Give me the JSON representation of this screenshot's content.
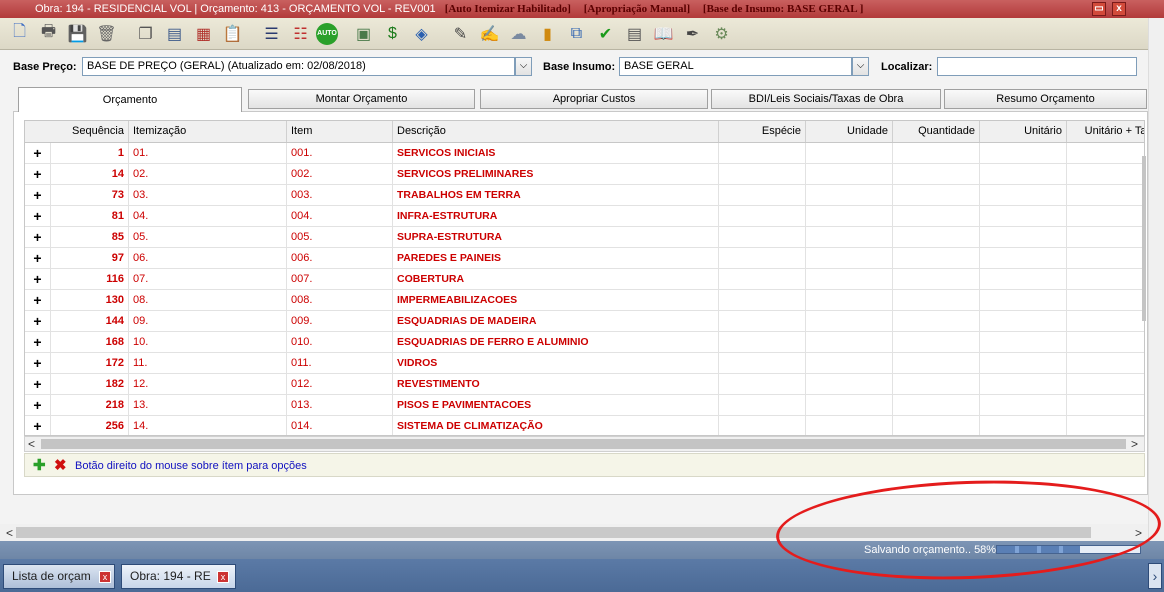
{
  "window": {
    "title": "Obra: 194 - RESIDENCIAL VOL | Orçamento: 413 - ORÇAMENTO VOL - REV001",
    "tags": [
      "[Auto Itemizar Habilitado]",
      "[Apropriação Manual]",
      "[Base de Insumo: BASE GERAL ]"
    ],
    "restore_icon": "▭",
    "close_icon": "x"
  },
  "toolbar": {
    "icons": [
      {
        "name": "new-document-icon",
        "glyph": "🗋",
        "color": "#3a6bc4"
      },
      {
        "name": "print-icon",
        "glyph": "🖶",
        "color": "#555"
      },
      {
        "name": "save-icon",
        "glyph": "💾",
        "color": "#2a4fa0"
      },
      {
        "name": "delete-icon",
        "glyph": "🗑",
        "color": "#666"
      },
      {
        "name": "copy-icon",
        "glyph": "❐",
        "color": "#555"
      },
      {
        "name": "report-icon",
        "glyph": "▤",
        "color": "#3d5a8a"
      },
      {
        "name": "table-icon",
        "glyph": "▦",
        "color": "#b0302a"
      },
      {
        "name": "clipboard-icon",
        "glyph": "📋",
        "color": "#666"
      },
      {
        "name": "list-icon",
        "glyph": "☰",
        "color": "#2a3a70"
      },
      {
        "name": "chart-list-icon",
        "glyph": "☷",
        "color": "#c03030"
      },
      {
        "name": "auto-icon",
        "glyph": "AUTO",
        "color": "#1a8a1a"
      },
      {
        "name": "calculator-icon",
        "glyph": "▣",
        "color": "#4a7a4a"
      },
      {
        "name": "money-icon",
        "glyph": "$",
        "color": "#1a7a1a"
      },
      {
        "name": "tag-icon",
        "glyph": "◈",
        "color": "#2a60b0"
      },
      {
        "name": "tools-icon",
        "glyph": "✎",
        "color": "#444"
      },
      {
        "name": "edit-icon",
        "glyph": "✍",
        "color": "#555"
      },
      {
        "name": "cloud-icon",
        "glyph": "☁",
        "color": "#7a8aa0"
      },
      {
        "name": "bar-chart-icon",
        "glyph": "▮",
        "color": "#d08a10"
      },
      {
        "name": "import-icon",
        "glyph": "⧉",
        "color": "#2a60b0"
      },
      {
        "name": "check-icon",
        "glyph": "✔",
        "color": "#1a9a1a"
      },
      {
        "name": "document-list-icon",
        "glyph": "▤",
        "color": "#555"
      },
      {
        "name": "book-icon",
        "glyph": "📖",
        "color": "#2a60b0"
      },
      {
        "name": "pen-icon",
        "glyph": "✒",
        "color": "#444"
      },
      {
        "name": "settings-icon",
        "glyph": "⚙",
        "color": "#6a8a5a"
      }
    ]
  },
  "filters": {
    "base_preco_label": "Base Preço:",
    "base_preco_value": "BASE DE PREÇO (GERAL) (Atualizado em: 02/08/2018)",
    "base_insumo_label": "Base Insumo:",
    "base_insumo_value": "BASE GERAL",
    "localizar_label": "Localizar:",
    "localizar_value": "",
    "dropdown_glyph": "⌵"
  },
  "tabs": [
    {
      "label": "Orçamento",
      "active": true
    },
    {
      "label": "Montar Orçamento",
      "active": false
    },
    {
      "label": "Apropriar Custos",
      "active": false
    },
    {
      "label": "BDI/Leis Sociais/Taxas de Obra",
      "active": false
    },
    {
      "label": "Resumo Orçamento",
      "active": false
    }
  ],
  "grid": {
    "columns": [
      "Sequência",
      "Itemização",
      "Item",
      "Descrição",
      "Espécie",
      "Unidade",
      "Quantidade",
      "Unitário",
      "Unitário + Tax"
    ],
    "expand_glyph": "+",
    "rows": [
      {
        "seq": "1",
        "itemizacao": "01.",
        "item": "001.",
        "descricao": "SERVICOS INICIAIS"
      },
      {
        "seq": "14",
        "itemizacao": "02.",
        "item": "002.",
        "descricao": "SERVICOS PRELIMINARES"
      },
      {
        "seq": "73",
        "itemizacao": "03.",
        "item": "003.",
        "descricao": "TRABALHOS EM TERRA"
      },
      {
        "seq": "81",
        "itemizacao": "04.",
        "item": "004.",
        "descricao": "INFRA-ESTRUTURA"
      },
      {
        "seq": "85",
        "itemizacao": "05.",
        "item": "005.",
        "descricao": "SUPRA-ESTRUTURA"
      },
      {
        "seq": "97",
        "itemizacao": "06.",
        "item": "006.",
        "descricao": "PAREDES E PAINEIS"
      },
      {
        "seq": "116",
        "itemizacao": "07.",
        "item": "007.",
        "descricao": "COBERTURA"
      },
      {
        "seq": "130",
        "itemizacao": "08.",
        "item": "008.",
        "descricao": "IMPERMEABILIZACOES"
      },
      {
        "seq": "144",
        "itemizacao": "09.",
        "item": "009.",
        "descricao": "ESQUADRIAS DE MADEIRA"
      },
      {
        "seq": "168",
        "itemizacao": "10.",
        "item": "010.",
        "descricao": "ESQUADRIAS DE FERRO E ALUMINIO"
      },
      {
        "seq": "172",
        "itemizacao": "11.",
        "item": "011.",
        "descricao": "VIDROS"
      },
      {
        "seq": "182",
        "itemizacao": "12.",
        "item": "012.",
        "descricao": "REVESTIMENTO"
      },
      {
        "seq": "218",
        "itemizacao": "13.",
        "item": "013.",
        "descricao": "PISOS E PAVIMENTACOES"
      },
      {
        "seq": "256",
        "itemizacao": "14.",
        "item": "014.",
        "descricao": "SISTEMA DE CLIMATIZAÇÃO"
      }
    ]
  },
  "footer": {
    "add_icon": "✚",
    "remove_icon": "✖",
    "hint": "Botão direito do mouse sobre ítem para opções"
  },
  "scroll": {
    "left": "<",
    "right": ">"
  },
  "status": {
    "text": "Salvando orçamento.. 58%",
    "progress": 0.58
  },
  "taskbar": {
    "tasks": [
      "Lista de orçam",
      "Obra: 194 - RE"
    ],
    "close_glyph": "x",
    "right_glyph": "›"
  },
  "colors": {
    "row_text": "#cc0000",
    "annotation": "#e41c1c"
  }
}
